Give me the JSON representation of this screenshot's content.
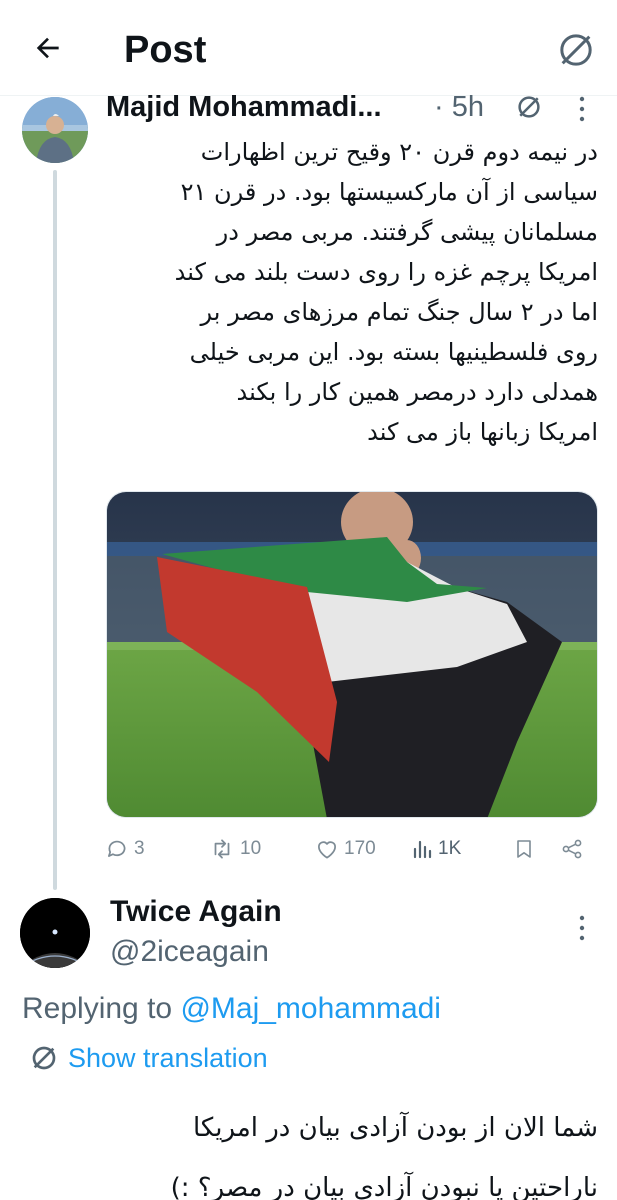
{
  "header": {
    "title": "Post",
    "back_icon": "arrow-left-icon",
    "translate_icon": "translate-globe-icon"
  },
  "post1": {
    "author_name": "Majid Mohammadi...",
    "time": "· 5h",
    "text_lines": [
      "در نیمه دوم قرن ۲۰ وقیح ترین اظهارات",
      "سیاسی از آن مارکسیستها بود. در قرن ۲۱",
      "مسلمانان پیشی گرفتند. مربی مصر در",
      "امریکا پرچم غزه را روی دست بلند می کند",
      "اما در ۲ سال جنگ تمام مرزهای مصر بر",
      "روی فلسطینیها بسته بود. این مربی خیلی",
      "همدلی دارد درمصر همین کار را بکند",
      "امریکا زبانها باز می کند"
    ],
    "media_description_icon": "photo-man-holding-palestinian-flag",
    "actions": {
      "replies": "3",
      "reposts": "10",
      "likes": "170",
      "views": "1K"
    }
  },
  "post2": {
    "author_name": "Twice Again",
    "handle": "@2iceagain",
    "replying_prefix": "Replying to",
    "replying_mention": "@Maj_mohammadi",
    "show_translation": "Show translation",
    "text_lines": [
      "شما الان از بودن آزادی بیان در امریکا",
      "ناراحتین یا نبودن آزادی بیان در مصر؟ :)"
    ]
  },
  "colors": {
    "text_primary": "#0f1419",
    "text_secondary": "#536471",
    "accent": "#1d9bf0",
    "thread_line": "#cfd9de"
  }
}
